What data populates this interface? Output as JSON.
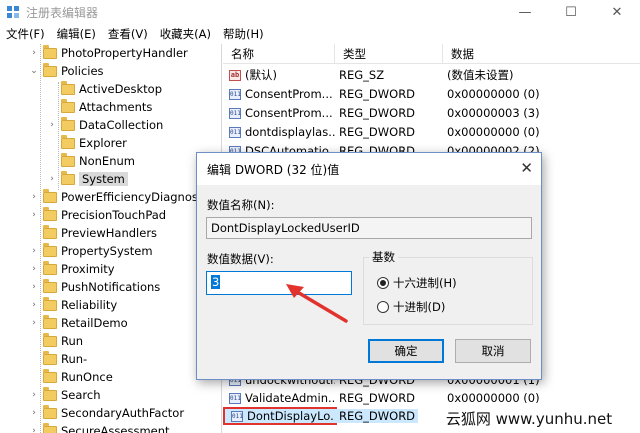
{
  "window": {
    "title": "注册表编辑器",
    "controls": [
      "—",
      "☐",
      "✕"
    ]
  },
  "menu": [
    "文件(F)",
    "编辑(E)",
    "查看(V)",
    "收藏夹(A)",
    "帮助(H)"
  ],
  "tree": [
    {
      "label": "PhotoPropertyHandler",
      "expander": "›",
      "level": 2
    },
    {
      "label": "Policies",
      "expander": "⌄",
      "level": 2
    },
    {
      "label": "ActiveDesktop",
      "expander": "",
      "level": 3
    },
    {
      "label": "Attachments",
      "expander": "",
      "level": 3
    },
    {
      "label": "DataCollection",
      "expander": "›",
      "level": 3
    },
    {
      "label": "Explorer",
      "expander": "",
      "level": 3
    },
    {
      "label": "NonEnum",
      "expander": "",
      "level": 3
    },
    {
      "label": "System",
      "expander": "›",
      "level": 3,
      "selected": true
    },
    {
      "label": "PowerEfficiencyDiagnostic",
      "expander": "›",
      "level": 2
    },
    {
      "label": "PrecisionTouchPad",
      "expander": "›",
      "level": 2
    },
    {
      "label": "PreviewHandlers",
      "expander": "",
      "level": 2
    },
    {
      "label": "PropertySystem",
      "expander": "›",
      "level": 2
    },
    {
      "label": "Proximity",
      "expander": "›",
      "level": 2
    },
    {
      "label": "PushNotifications",
      "expander": "›",
      "level": 2
    },
    {
      "label": "Reliability",
      "expander": "›",
      "level": 2
    },
    {
      "label": "RetailDemo",
      "expander": "›",
      "level": 2
    },
    {
      "label": "Run",
      "expander": "",
      "level": 2
    },
    {
      "label": "Run-",
      "expander": "",
      "level": 2
    },
    {
      "label": "RunOnce",
      "expander": "",
      "level": 2
    },
    {
      "label": "Search",
      "expander": "›",
      "level": 2
    },
    {
      "label": "SecondaryAuthFactor",
      "expander": "›",
      "level": 2
    },
    {
      "label": "SecureAssessment",
      "expander": "›",
      "level": 2
    }
  ],
  "list": {
    "headers": [
      "名称",
      "类型",
      "数据"
    ],
    "rows": [
      {
        "icon": "ab",
        "name": "(默认)",
        "type": "REG_SZ",
        "data": "(数值未设置)"
      },
      {
        "icon": "011",
        "name": "ConsentProm...",
        "type": "REG_DWORD",
        "data": "0x00000000 (0)"
      },
      {
        "icon": "011",
        "name": "ConsentProm...",
        "type": "REG_DWORD",
        "data": "0x00000003 (3)"
      },
      {
        "icon": "011",
        "name": "dontdisplaylas...",
        "type": "REG_DWORD",
        "data": "0x00000000 (0)"
      },
      {
        "icon": "011",
        "name": "DSCAutomatio...",
        "type": "REG_DWORD",
        "data": "0x00000002 (2)"
      }
    ],
    "bottom_rows": [
      {
        "icon": "011",
        "name": "undockwithoutl...",
        "type": "REG_DWORD",
        "data": "0x00000001 (1)"
      },
      {
        "icon": "011",
        "name": "ValidateAdmin...",
        "type": "REG_DWORD",
        "data": "0x00000000 (0)"
      },
      {
        "icon": "011",
        "name": "DontDisplayLo...",
        "type": "REG_DWORD",
        "data": ""
      }
    ]
  },
  "dialog": {
    "title": "编辑 DWORD (32 位)值",
    "value_name_label": "数值名称(N):",
    "value_name": "DontDisplayLockedUserID",
    "value_data_label": "数值数据(V):",
    "value_data": "3",
    "base_label": "基数",
    "radio_hex": "十六进制(H)",
    "radio_dec": "十进制(D)",
    "ok": "确定",
    "cancel": "取消",
    "close": "✕"
  },
  "watermark": "云狐网 www.yunhu.net",
  "colors": {
    "highlight": "#e2322d",
    "arrow": "#e2322d",
    "accent": "#0078d7"
  }
}
